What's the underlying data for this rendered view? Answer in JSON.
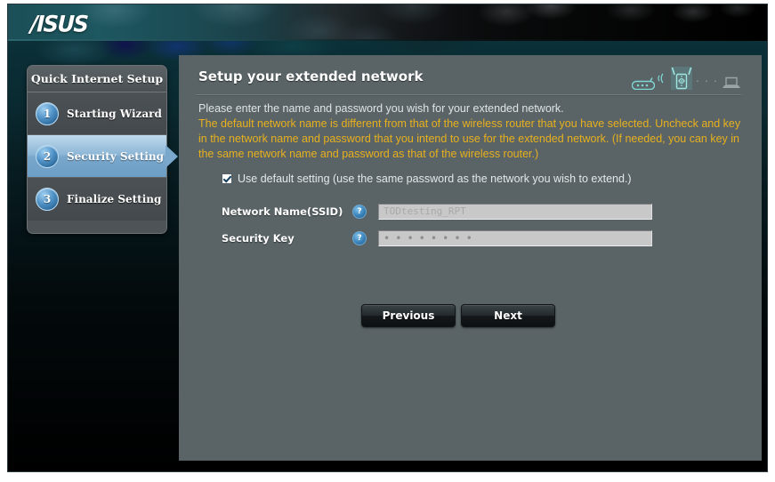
{
  "brand": {
    "logo_text": "/ISUS"
  },
  "sidebar": {
    "title": "Quick Internet Setup",
    "items": [
      {
        "num": "1",
        "label": "Starting Wizard",
        "active": false
      },
      {
        "num": "2",
        "label": "Security Setting",
        "active": true
      },
      {
        "num": "3",
        "label": "Finalize Setting",
        "active": false
      }
    ]
  },
  "panel": {
    "title": "Setup your extended network",
    "intro_text": "Please enter the name and password you wish for your extended network.",
    "warning_text": "The default network name is different from that of the wireless router that you have selected. Uncheck and key in the network name and password that you intend to use for the extended network. (If needed, you can key in the same network name and password as that of the wireless router.)",
    "topology": {
      "router_icon": "router-icon",
      "wave_icon": "wireless-signal-icon",
      "repeater_icon": "range-extender-icon",
      "dots_icon": "connection-dots-icon",
      "computer_icon": "computer-icon",
      "dots_text": "· · ·"
    }
  },
  "form": {
    "checkbox_label": "Use default setting (use the same password as the network you wish to extend.)",
    "checkbox_checked": true,
    "help_glyph": "?",
    "fields": [
      {
        "label": "Network Name(SSID)",
        "value": "TODtesting_RPT",
        "placeholder": "",
        "type": "text",
        "disabled": true
      },
      {
        "label": "Security Key",
        "value": "••••••••",
        "placeholder": "",
        "type": "password",
        "disabled": true
      }
    ]
  },
  "buttons": {
    "previous_label": "Previous",
    "next_label": "Next"
  },
  "colors": {
    "accent_blue": "#79a8cc",
    "warning_yellow": "#e8b01c",
    "panel_gray": "#5a6467",
    "banner_teal": "#1c4f57"
  }
}
